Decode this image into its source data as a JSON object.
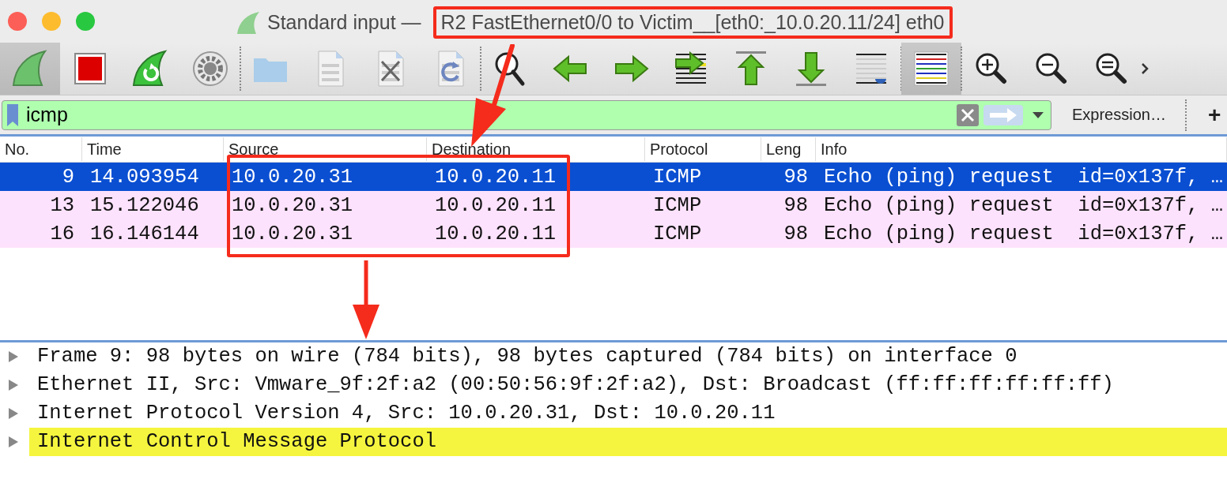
{
  "window": {
    "title": "Standard input — ",
    "title_highlight": "R2 FastEthernet0/0 to Victim__[eth0:_10.0.20.11/24] eth0"
  },
  "display_filter": {
    "value": "icmp",
    "expression_button": "Expression…",
    "add_button": "+"
  },
  "packet_list": {
    "columns": [
      "No.",
      "Time",
      "Source",
      "Destination",
      "Protocol",
      "Leng",
      "Info"
    ],
    "rows": [
      {
        "selected": true,
        "cells": [
          "9",
          "14.093954",
          "10.0.20.31",
          "10.0.20.11",
          "ICMP",
          "98",
          "Echo (ping) request  id=0x137f, …"
        ]
      },
      {
        "selected": false,
        "cells": [
          "13",
          "15.122046",
          "10.0.20.31",
          "10.0.20.11",
          "ICMP",
          "98",
          "Echo (ping) request  id=0x137f, …"
        ]
      },
      {
        "selected": false,
        "cells": [
          "16",
          "16.146144",
          "10.0.20.31",
          "10.0.20.11",
          "ICMP",
          "98",
          "Echo (ping) request  id=0x137f, …"
        ]
      }
    ]
  },
  "packet_details": [
    {
      "text": "Frame 9: 98 bytes on wire (784 bits), 98 bytes captured (784 bits) on interface 0",
      "expanded": false,
      "selected": false
    },
    {
      "text": "Ethernet II, Src: Vmware_9f:2f:a2 (00:50:56:9f:2f:a2), Dst: Broadcast (ff:ff:ff:ff:ff:ff)",
      "expanded": false,
      "selected": false
    },
    {
      "text": "Internet Protocol Version 4, Src: 10.0.20.31, Dst: 10.0.20.11",
      "expanded": false,
      "selected": false
    },
    {
      "text": "Internet Control Message Protocol",
      "expanded": false,
      "selected": true
    }
  ],
  "annotations": [
    {
      "kind": "box"
    },
    {
      "kind": "box"
    },
    {
      "kind": "arrow"
    },
    {
      "kind": "arrow"
    }
  ]
}
